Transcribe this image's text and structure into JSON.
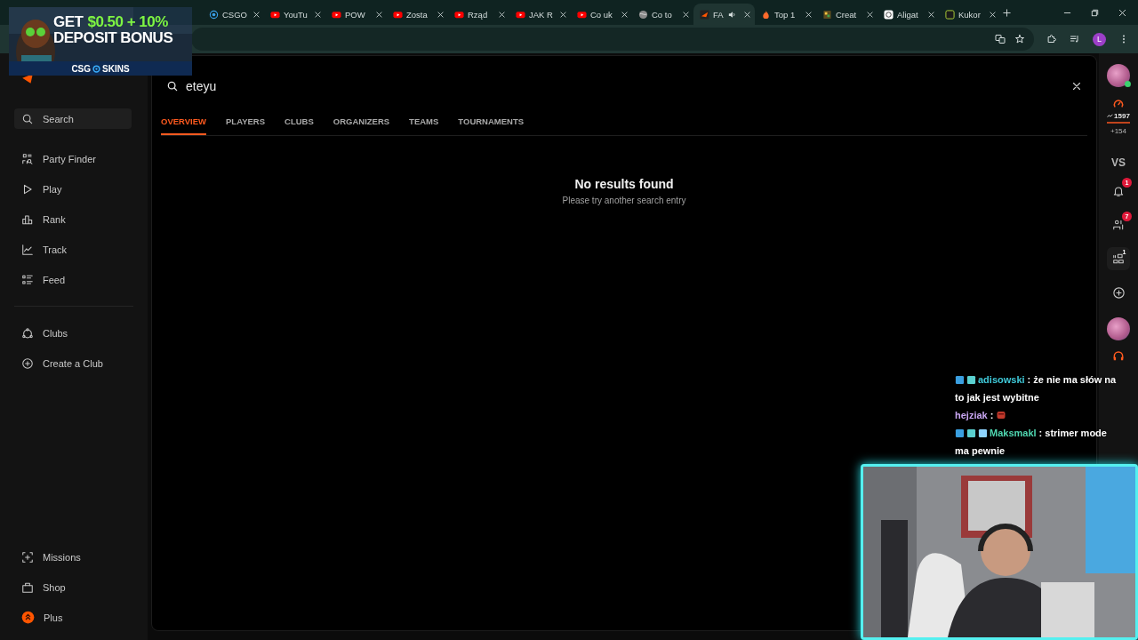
{
  "browser": {
    "tabs": [
      {
        "title": "CSGO",
        "kind": "target",
        "selected": false,
        "audio": false
      },
      {
        "title": "YouTu",
        "kind": "youtube",
        "selected": false,
        "audio": false
      },
      {
        "title": "POW",
        "kind": "youtube",
        "selected": false,
        "audio": false
      },
      {
        "title": "Zosta",
        "kind": "youtube",
        "selected": false,
        "audio": false
      },
      {
        "title": "Rząd",
        "kind": "youtube",
        "selected": false,
        "audio": false
      },
      {
        "title": "JAK R",
        "kind": "youtube",
        "selected": false,
        "audio": false
      },
      {
        "title": "Co uk",
        "kind": "youtube",
        "selected": false,
        "audio": false
      },
      {
        "title": "Co to",
        "kind": "globe",
        "selected": false,
        "audio": false
      },
      {
        "title": "FA",
        "kind": "faceit",
        "selected": true,
        "audio": true
      },
      {
        "title": "Top 1",
        "kind": "fire",
        "selected": false,
        "audio": false
      },
      {
        "title": "Creat",
        "kind": "doc",
        "selected": false,
        "audio": false
      },
      {
        "title": "Aligat",
        "kind": "bot",
        "selected": false,
        "audio": false
      },
      {
        "title": "Kukor",
        "kind": "square",
        "selected": false,
        "audio": false
      }
    ],
    "profile_initial": "L"
  },
  "ad": {
    "lead": "GET",
    "highlight": "$0.50 + 10%",
    "line2": "DEPOSIT BONUS",
    "brand_left": "CSG",
    "brand_right": "SKINS"
  },
  "sidebar": {
    "nav": [
      {
        "label": "Search",
        "kind": "search",
        "highlighted": true
      },
      {
        "label": "Party Finder",
        "kind": "party",
        "highlighted": false
      },
      {
        "label": "Play",
        "kind": "play",
        "highlighted": false
      },
      {
        "label": "Rank",
        "kind": "rank",
        "highlighted": false
      },
      {
        "label": "Track",
        "kind": "track",
        "highlighted": false
      },
      {
        "label": "Feed",
        "kind": "feed",
        "highlighted": false
      }
    ],
    "clubs": [
      {
        "label": "Clubs",
        "kind": "clubs",
        "highlighted": false
      },
      {
        "label": "Create a Club",
        "kind": "plus",
        "highlighted": false
      }
    ],
    "footer": [
      {
        "label": "Missions",
        "kind": "missions",
        "highlighted": false
      },
      {
        "label": "Shop",
        "kind": "shop",
        "highlighted": false
      },
      {
        "label": "Plus",
        "kind": "plusbadge",
        "highlighted": false
      }
    ]
  },
  "search": {
    "value": "eteyu",
    "tabs": [
      {
        "label": "OVERVIEW",
        "selected": true
      },
      {
        "label": "PLAYERS",
        "selected": false
      },
      {
        "label": "CLUBS",
        "selected": false
      },
      {
        "label": "ORGANIZERS",
        "selected": false
      },
      {
        "label": "TEAMS",
        "selected": false
      },
      {
        "label": "TOURNAMENTS",
        "selected": false
      }
    ],
    "empty_title": "No results found",
    "empty_hint": "Please try another search entry"
  },
  "rail": {
    "elo": "1597",
    "elo_change": "+154",
    "vs": "VS",
    "notifications": "1",
    "friends": "7",
    "party": "1"
  },
  "chat": {
    "messages": [
      {
        "user": "adisowski",
        "color": "#3fc8d8",
        "separator": ":",
        "kind": "text",
        "lines": [
          "że nie ma słów na",
          "to jak jest wybitne"
        ]
      },
      {
        "user": "hejziak",
        "color": "#c9a6f2",
        "separator": ":",
        "kind": "emote"
      },
      {
        "user": "Maksmakl",
        "color": "#4fd6b0",
        "separator": ":",
        "kind": "text",
        "lines": [
          "strimer mode",
          "ma pewnie"
        ]
      }
    ]
  }
}
